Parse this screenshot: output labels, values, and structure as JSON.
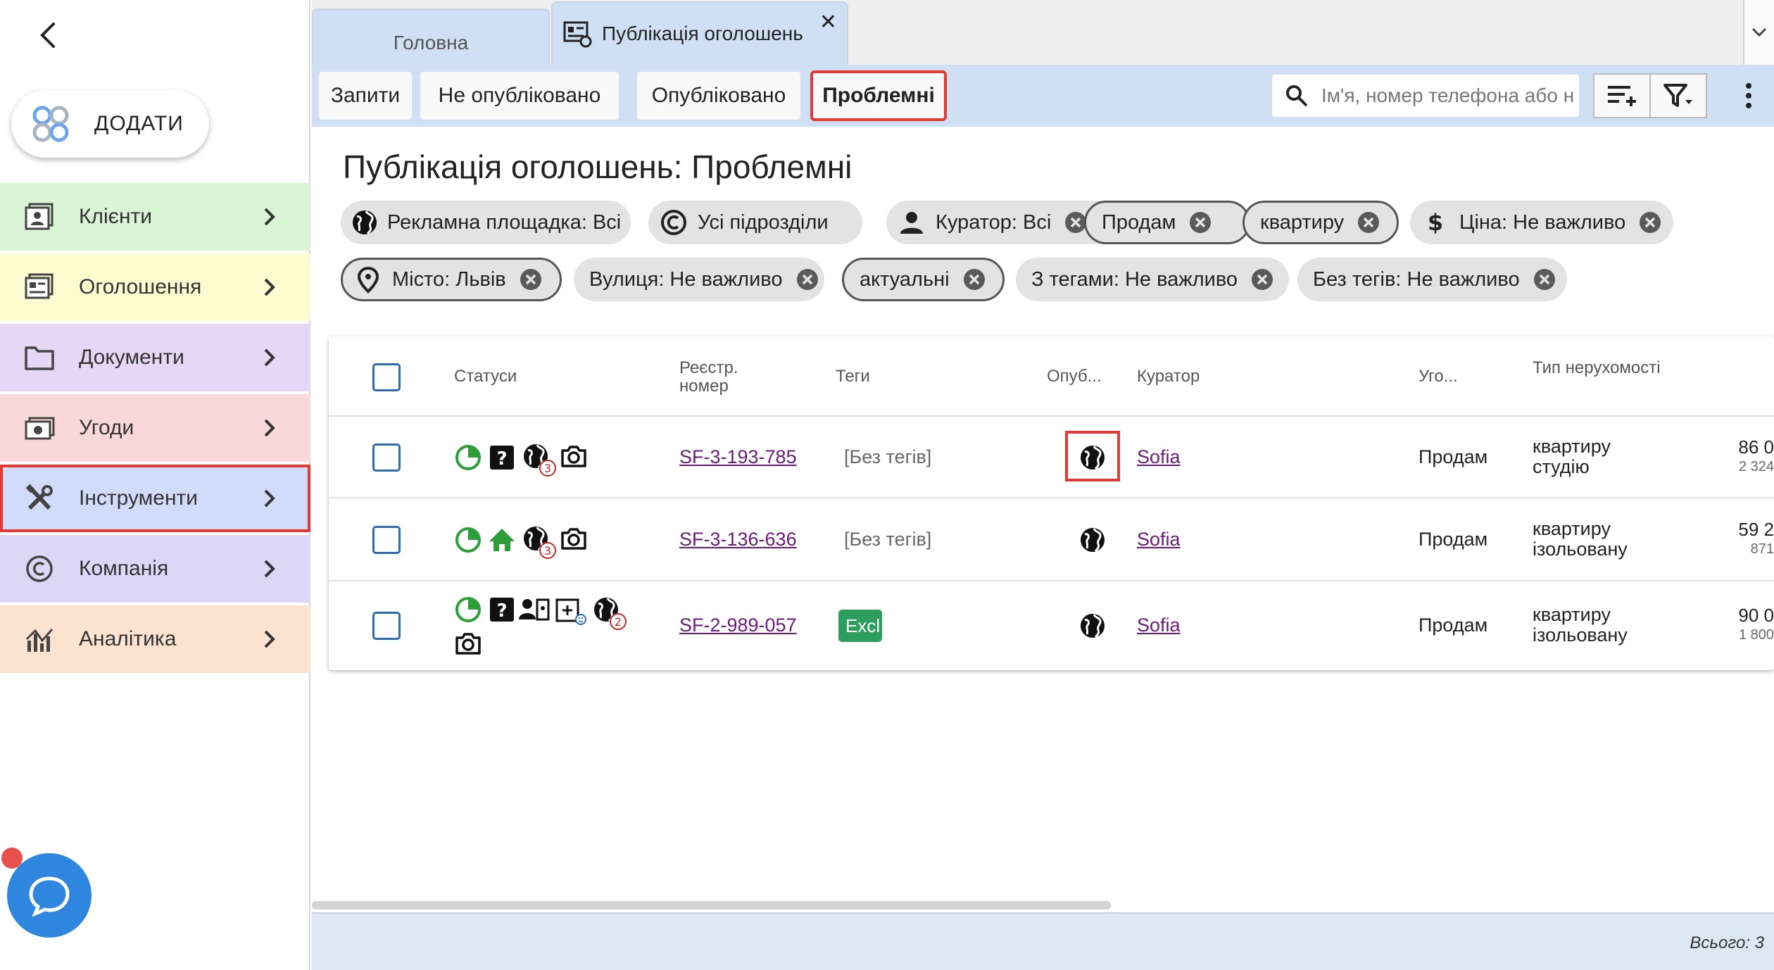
{
  "sidebar": {
    "add_label": "ДОДАТИ",
    "items": [
      {
        "label": "Клієнти",
        "color": "#d9f5d6",
        "icon": "client-card-icon"
      },
      {
        "label": "Оголошення",
        "color": "#fbfbcf",
        "icon": "listing-board-icon"
      },
      {
        "label": "Документи",
        "color": "#e6d7f7",
        "icon": "folder-icon"
      },
      {
        "label": "Угоди",
        "color": "#f8d8d8",
        "icon": "money-icon"
      },
      {
        "label": "Інструменти",
        "color": "#d2dcfa",
        "icon": "tools-icon",
        "selected": true
      },
      {
        "label": "Компанія",
        "color": "#dcd6f7",
        "icon": "copyright-icon"
      },
      {
        "label": "Аналітика",
        "color": "#fbe3cf",
        "icon": "analytics-icon"
      }
    ]
  },
  "tabs": {
    "home": "Головна",
    "current": "Публікація оголошень",
    "close": "✕"
  },
  "toolbar": {
    "views": [
      "Запити",
      "Не опубліковано",
      "Опубліковано",
      "Проблемні"
    ],
    "active_view": "Проблемні",
    "search_placeholder": "Ім'я, номер телефона або н"
  },
  "page": {
    "title": "Публікація оголошень: Проблемні"
  },
  "filters": [
    {
      "label": "Рекламна площадка: Всі",
      "icon": "globe-icon",
      "outlined": false,
      "removable": false
    },
    {
      "label": "Усі підрозділи",
      "icon": "copyright-icon",
      "outlined": false,
      "removable": false
    },
    {
      "label": "Куратор: Всі",
      "icon": "person-icon",
      "outlined": false,
      "removable": true
    },
    {
      "label": "Продам",
      "icon": "",
      "outlined": true,
      "removable": true
    },
    {
      "label": "квартиру",
      "icon": "",
      "outlined": true,
      "removable": true
    },
    {
      "label": "Ціна: Не важливо",
      "icon": "dollar-icon",
      "outlined": false,
      "removable": true
    },
    {
      "label": "Місто: Львів",
      "icon": "location-pin-icon",
      "outlined": true,
      "removable": true
    },
    {
      "label": "Вулиця: Не важливо",
      "icon": "",
      "outlined": false,
      "removable": true
    },
    {
      "label": "актуальні",
      "icon": "",
      "outlined": true,
      "removable": true
    },
    {
      "label": "З тегами: Не важливо",
      "icon": "",
      "outlined": false,
      "removable": true
    },
    {
      "label": "Без тегів: Не важливо",
      "icon": "",
      "outlined": false,
      "removable": true
    }
  ],
  "table": {
    "headers": {
      "statuses": "Статуси",
      "reg_number": "Реєстр. номер",
      "tags": "Теги",
      "published": "Опуб...",
      "curator": "Куратор",
      "deal": "Уго...",
      "property_type": "Тип нерухомості"
    },
    "rows": [
      {
        "reg": "SF-3-193-785",
        "tags": "[Без тегів]",
        "curator": "Sofia",
        "deal": "Продам",
        "type1": "квартиру",
        "type2": "студію",
        "price": "86 0",
        "price_sub": "2 324",
        "globe_count": "3"
      },
      {
        "reg": "SF-3-136-636",
        "tags": "[Без тегів]",
        "curator": "Sofia",
        "deal": "Продам",
        "type1": "квартиру",
        "type2": "ізольовану",
        "price": "59 2",
        "price_sub": "871",
        "globe_count": "3"
      },
      {
        "reg": "SF-2-989-057",
        "tags": "Excl",
        "curator": "Sofia",
        "deal": "Продам",
        "type1": "квартиру",
        "type2": "ізольовану",
        "price": "90 0",
        "price_sub": "1 800",
        "globe_count": "2"
      }
    ]
  },
  "footer": {
    "total": "Всього: 3"
  },
  "colors": {
    "accent_red": "#e53935",
    "tab_blue": "#cfe0f4",
    "link_purple": "#6a1b7a",
    "status_green": "#2e9e3a",
    "checkbox_blue": "#2d6bb3"
  }
}
